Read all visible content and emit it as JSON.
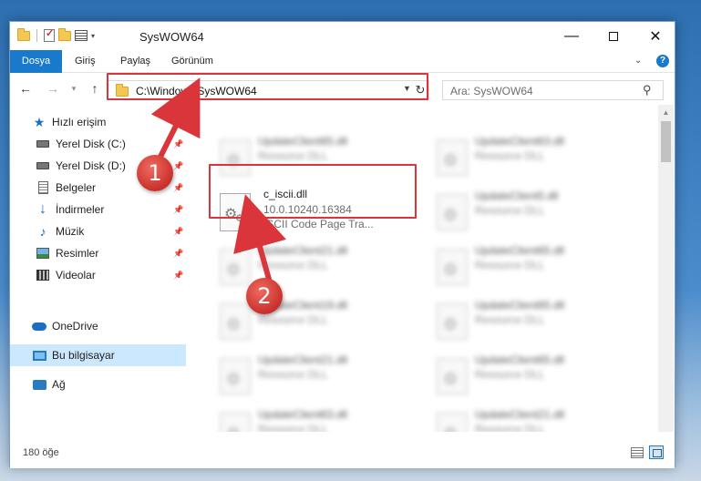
{
  "window": {
    "title": "SysWOW64",
    "minimize_glyph": "—",
    "close_glyph": "✕"
  },
  "ribbon": {
    "tabs": [
      "Dosya",
      "Giriş",
      "Paylaş",
      "Görünüm"
    ],
    "help_glyph": "?"
  },
  "address": {
    "path": "C:\\Windows\\SysWOW64",
    "search_placeholder": "Ara: SysWOW64"
  },
  "nav_pane": {
    "items": [
      {
        "label": "Hızlı erişim",
        "icon": "star-icon",
        "pinned": false
      },
      {
        "label": "Yerel Disk (C:)",
        "icon": "disk-icon",
        "pinned": true
      },
      {
        "label": "Yerel Disk (D:)",
        "icon": "disk-icon",
        "pinned": true
      },
      {
        "label": "Belgeler",
        "icon": "documents-icon",
        "pinned": true
      },
      {
        "label": "İndirmeler",
        "icon": "download-icon",
        "pinned": true
      },
      {
        "label": "Müzik",
        "icon": "music-icon",
        "pinned": true
      },
      {
        "label": "Resimler",
        "icon": "pictures-icon",
        "pinned": true
      },
      {
        "label": "Videolar",
        "icon": "videos-icon",
        "pinned": true
      },
      {
        "label": "OneDrive",
        "icon": "onedrive-icon",
        "pinned": false
      },
      {
        "label": "Bu bilgisayar",
        "icon": "this-pc-icon",
        "pinned": false,
        "selected": true
      },
      {
        "label": "Ağ",
        "icon": "network-icon",
        "pinned": false
      }
    ]
  },
  "files": {
    "highlighted": {
      "name": "c_iscii.dll",
      "version": "10.0.10240.16384",
      "description": "ISCII Code Page Tra..."
    },
    "blurred_left": [
      {
        "name": "UpdateClient65.dll",
        "type": "Resource DLL"
      },
      {
        "name": "UpdateClient21.dll",
        "type": "Resource DLL"
      },
      {
        "name": "UpdateClient19.dll",
        "type": "Resource DLL"
      },
      {
        "name": "UpdateClient21.dll",
        "type": "Resource DLL"
      },
      {
        "name": "UpdateClient63.dll",
        "type": "Resource DLL"
      }
    ],
    "blurred_right": [
      {
        "name": "UpdateClient63.dll",
        "type": "Resource DLL"
      },
      {
        "name": "UpdateClient5.dll",
        "type": "Resource DLL"
      },
      {
        "name": "UpdateClient65.dll",
        "type": "Resource DLL"
      },
      {
        "name": "UpdateClient65.dll",
        "type": "Resource DLL"
      },
      {
        "name": "UpdateClient65.dll",
        "type": "Resource DLL"
      },
      {
        "name": "UpdateClient21.dll",
        "type": "Resource DLL"
      }
    ]
  },
  "status": {
    "item_count": "180 öğe"
  },
  "annotations": {
    "steps": [
      "1",
      "2"
    ],
    "color": "#d9353a"
  }
}
